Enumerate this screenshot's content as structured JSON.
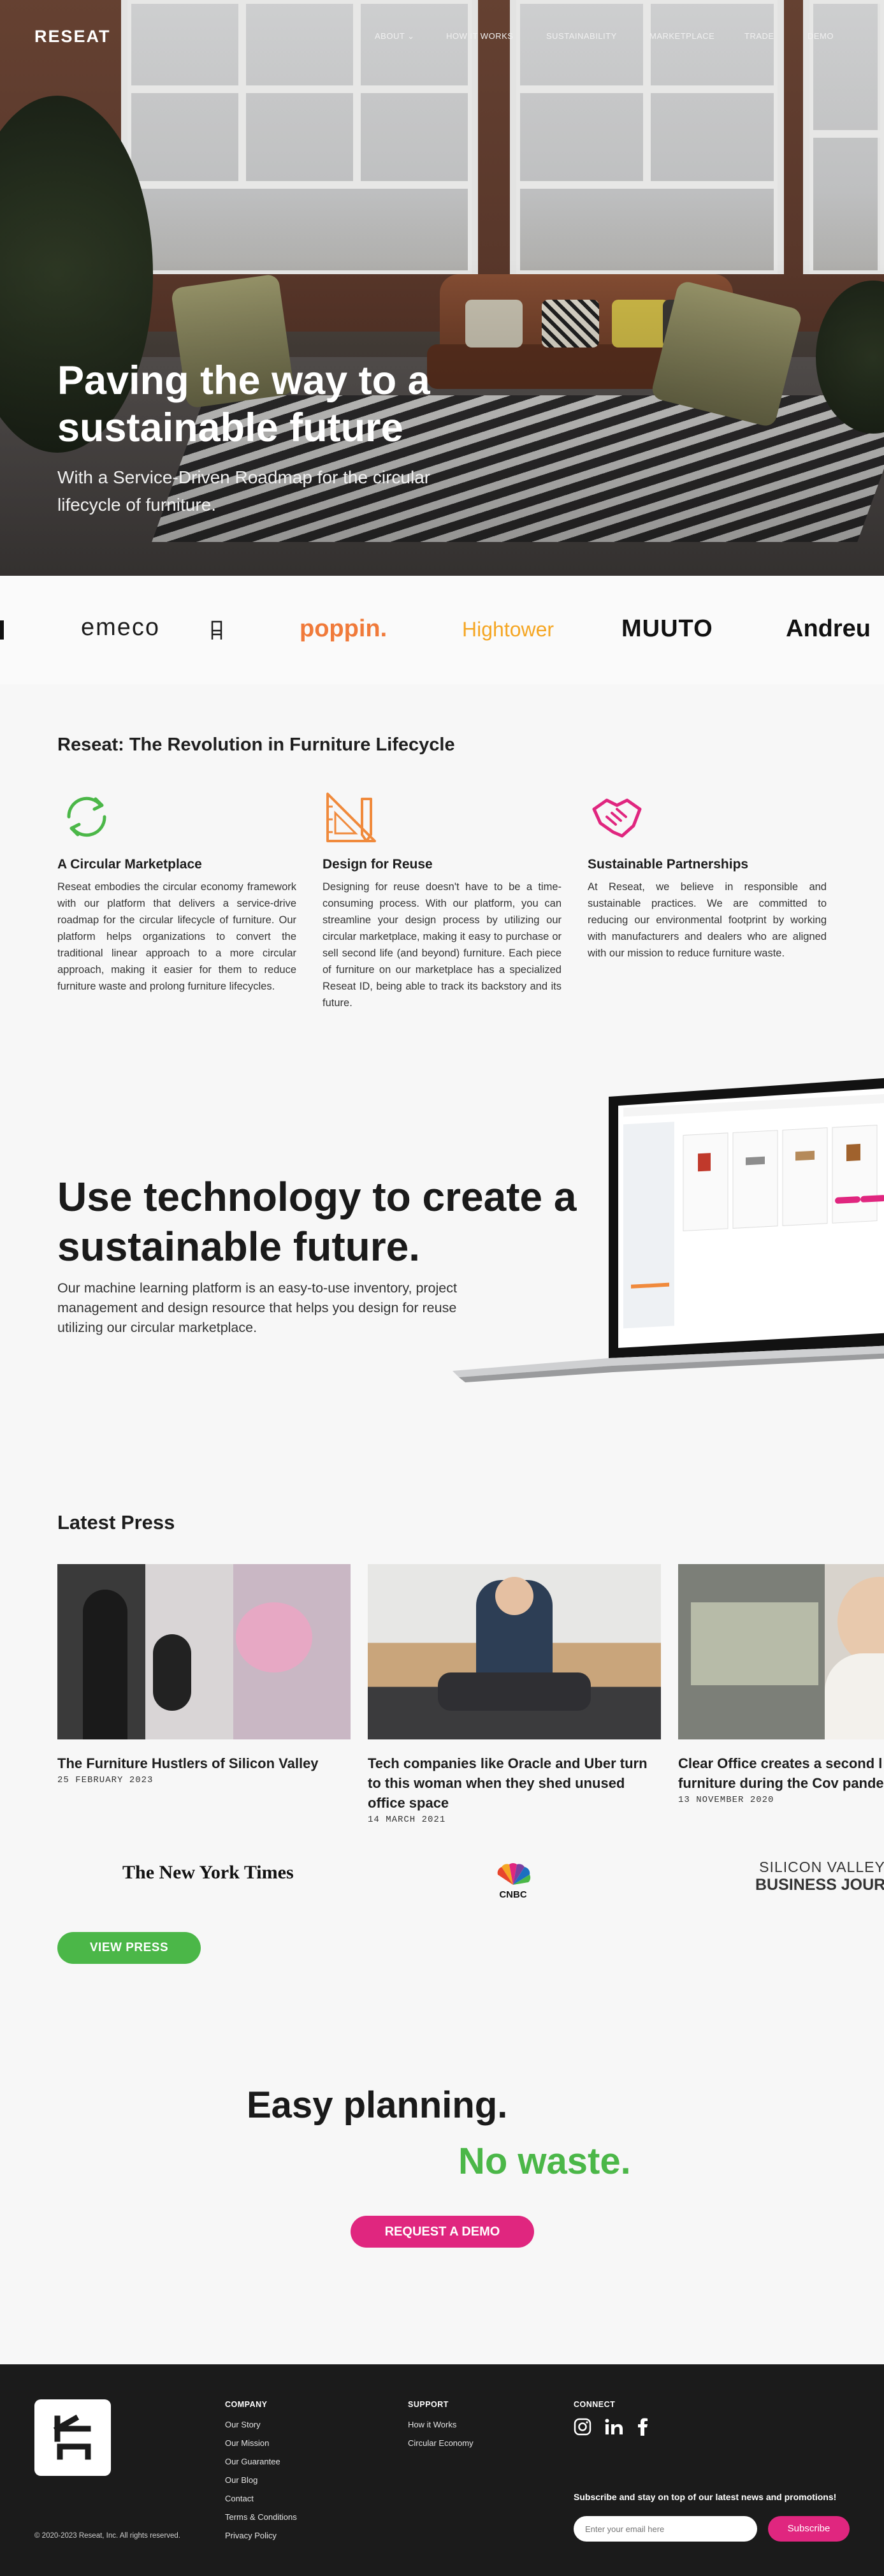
{
  "nav": {
    "logo": "RESEAT",
    "links": [
      "ABOUT ⌄",
      "HOW IT WORKS",
      "SUSTAINABILITY",
      "MARKETPLACE",
      "TRADE",
      "DEMO"
    ]
  },
  "hero": {
    "title": "Paving the way to a sustainable future",
    "subtitle": "With a Service-Driven Roadmap for the circular lifecycle of furniture."
  },
  "brands": [
    "emeco",
    "poppin.",
    "Hightower",
    "MUUTO",
    "Andreu"
  ],
  "revolution": {
    "title": "Reseat: The Revolution in Furniture Lifecycle",
    "features": [
      {
        "icon": "recycle-arrows-icon",
        "title": "A Circular Marketplace",
        "text": "Reseat embodies the circular economy framework with our platform that delivers a service-drive roadmap for the circular lifecycle of furniture. Our platform helps organizations to convert the traditional linear approach to a more circular approach, making it easier for them to reduce furniture waste and prolong furniture lifecycles."
      },
      {
        "icon": "design-tools-icon",
        "title": "Design for Reuse",
        "text": "Designing for reuse doesn't have to be a time-consuming process. With our platform, you can streamline your design process by utilizing our circular marketplace, making it easy to purchase or sell second life (and beyond) furniture. Each piece of furniture on our marketplace has a specialized Reseat ID, being able to track its backstory and its future."
      },
      {
        "icon": "handshake-icon",
        "title": "Sustainable Partnerships",
        "text": "At Reseat, we believe in responsible and sustainable practices. We are committed to reducing our environmental footprint by working with manufacturers and dealers who are aligned with our mission to reduce furniture waste."
      }
    ]
  },
  "tech": {
    "title": "Use technology to create a sustainable future.",
    "subtitle": "Our machine learning platform is an easy-to-use inventory, project management and design resource that helps you design for reuse utilizing our circular marketplace."
  },
  "press": {
    "title": "Latest Press",
    "articles": [
      {
        "title": "The Furniture Hustlers of Silicon Valley",
        "date": "25 FEBRUARY 2023"
      },
      {
        "title": "Tech companies like Oracle and Uber turn to this woman when they shed unused office space",
        "date": "14 MARCH 2021"
      },
      {
        "title": "Clear Office creates a second l office furniture during the Cov pandemic",
        "date": "13 NOVEMBER 2020"
      }
    ],
    "outlets": [
      "The New York Times",
      "CNBC",
      "SILICON VALLEY",
      "BUSINESS JOURNA"
    ],
    "button": "VIEW PRESS"
  },
  "cta": {
    "line1": "Easy planning.",
    "line2": "No waste.",
    "button": "REQUEST A DEMO"
  },
  "footer": {
    "copyright": "© 2020-2023 Reseat, Inc. All rights reserved.",
    "company": {
      "heading": "COMPANY",
      "links": [
        "Our Story",
        "Our Mission",
        "Our Guarantee",
        "Our Blog",
        "Contact",
        "Terms & Conditions",
        "Privacy Policy"
      ]
    },
    "support": {
      "heading": "SUPPORT",
      "links": [
        "How it Works",
        "Circular Economy"
      ]
    },
    "connect": {
      "heading": "CONNECT"
    },
    "subscribe_text": "Subscribe and stay on top of our latest news and promotions!",
    "email_placeholder": "Enter your email here",
    "subscribe_button": "Subscribe"
  },
  "colors": {
    "green": "#4bb748",
    "pink": "#e0267f",
    "orange": "#f08a3c",
    "dark": "#1b1b1b"
  }
}
